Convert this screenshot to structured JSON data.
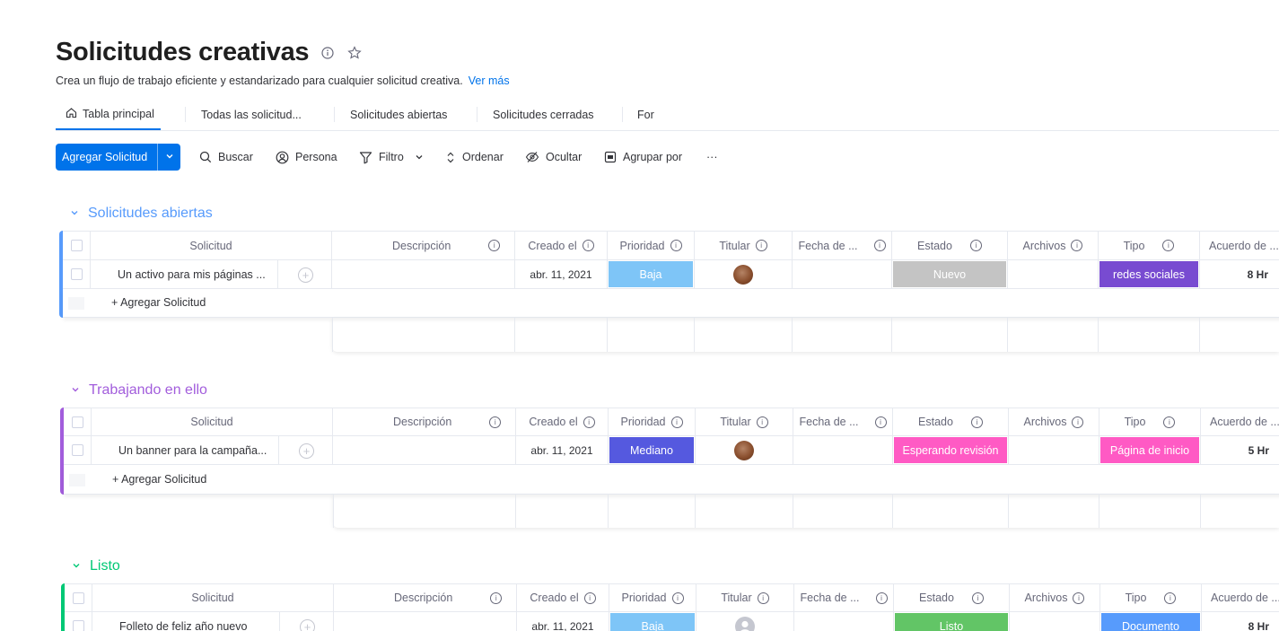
{
  "header": {
    "title": "Solicitudes creativas",
    "subtitle": "Crea un flujo de trabajo eficiente y estandarizado para cualquier solicitud creativa.",
    "more_link": "Ver más"
  },
  "tabs": [
    {
      "label": "Tabla principal",
      "icon": "home-icon",
      "active": true
    },
    {
      "label": "Todas las solicitud..."
    },
    {
      "label": "Solicitudes abiertas"
    },
    {
      "label": "Solicitudes cerradas"
    },
    {
      "label": "For"
    }
  ],
  "toolbar": {
    "add_label": "Agregar Solicitud",
    "search": "Buscar",
    "person": "Persona",
    "filter": "Filtro",
    "sort": "Ordenar",
    "hide": "Ocultar",
    "group_by": "Agrupar por",
    "more": "···"
  },
  "columns": {
    "solicitud": "Solicitud",
    "descripcion": "Descripción",
    "creado": "Creado el",
    "prioridad": "Prioridad",
    "titular": "Titular",
    "fecha": "Fecha de ...",
    "estado": "Estado",
    "archivos": "Archivos",
    "tipo": "Tipo",
    "acuerdo": "Acuerdo de ..."
  },
  "add_item_label": "+ Agregar Solicitud",
  "colors": {
    "accent": "#0073ea",
    "group_open": "#579bfc",
    "group_working": "#a25ddc",
    "group_done": "#00c875",
    "priority_low": "#7ec5f7",
    "priority_medium": "#5559df",
    "status_new": "#c4c4c4",
    "status_review": "#ff5ac4",
    "status_done": "#62c566",
    "type_social": "#784bd1",
    "type_home": "#ff5ac4",
    "type_doc": "#579bfc"
  },
  "groups": [
    {
      "title": "Solicitudes abiertas",
      "item": {
        "name": "Un activo para mis páginas ...",
        "created": "abr. 11, 2021",
        "priority": "Baja",
        "status": "Nuevo",
        "type": "redes sociales",
        "sla": "8 Hr"
      }
    },
    {
      "title": "Trabajando en ello",
      "item": {
        "name": "Un banner para la campaña...",
        "created": "abr. 11, 2021",
        "priority": "Mediano",
        "status": "Esperando revisión",
        "type": "Página de inicio",
        "sla": "5 Hr"
      }
    },
    {
      "title": "Listo",
      "item": {
        "name": "Folleto de feliz año nuevo",
        "created": "abr. 11, 2021",
        "priority": "Baja",
        "status": "Listo",
        "type": "Documento",
        "sla": "8 Hr"
      }
    }
  ]
}
